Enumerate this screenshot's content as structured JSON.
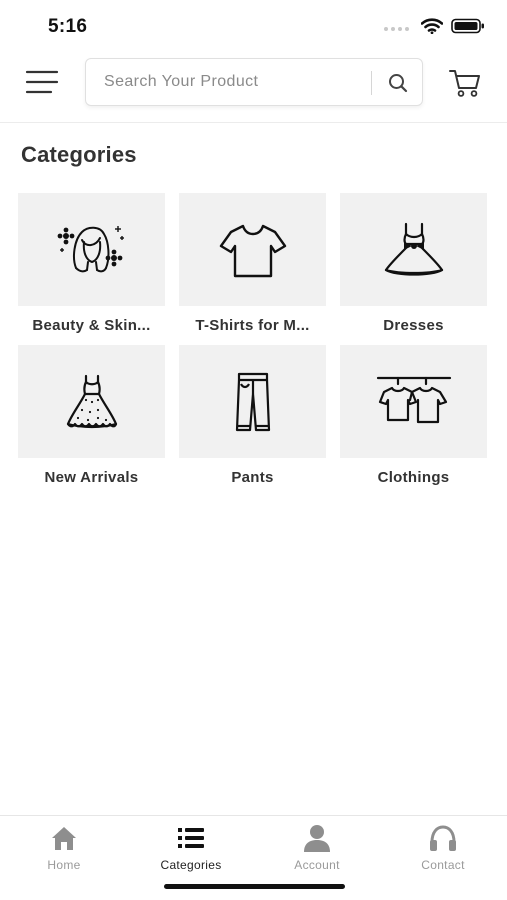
{
  "status_bar": {
    "time": "5:16"
  },
  "header": {
    "search": {
      "placeholder": "Search Your Product",
      "value": ""
    }
  },
  "page": {
    "title": "Categories"
  },
  "categories": [
    {
      "label": "Beauty & Skin...",
      "icon": "woman-face-icon"
    },
    {
      "label": "T-Shirts for M...",
      "icon": "tshirt-icon"
    },
    {
      "label": "Dresses",
      "icon": "dress-bow-icon"
    },
    {
      "label": "New Arrivals",
      "icon": "dress-icon"
    },
    {
      "label": "Pants",
      "icon": "pants-icon"
    },
    {
      "label": "Clothings",
      "icon": "clothes-rack-icon"
    }
  ],
  "bottom_nav": {
    "active": "Categories",
    "items": [
      {
        "label": "Home",
        "icon": "home-icon"
      },
      {
        "label": "Categories",
        "icon": "list-icon"
      },
      {
        "label": "Account",
        "icon": "user-icon"
      },
      {
        "label": "Contact",
        "icon": "headphones-icon"
      }
    ]
  },
  "colors": {
    "tile_background": "#f1f1f1",
    "active_nav": "#222222",
    "inactive_nav": "#9a9a9a"
  }
}
